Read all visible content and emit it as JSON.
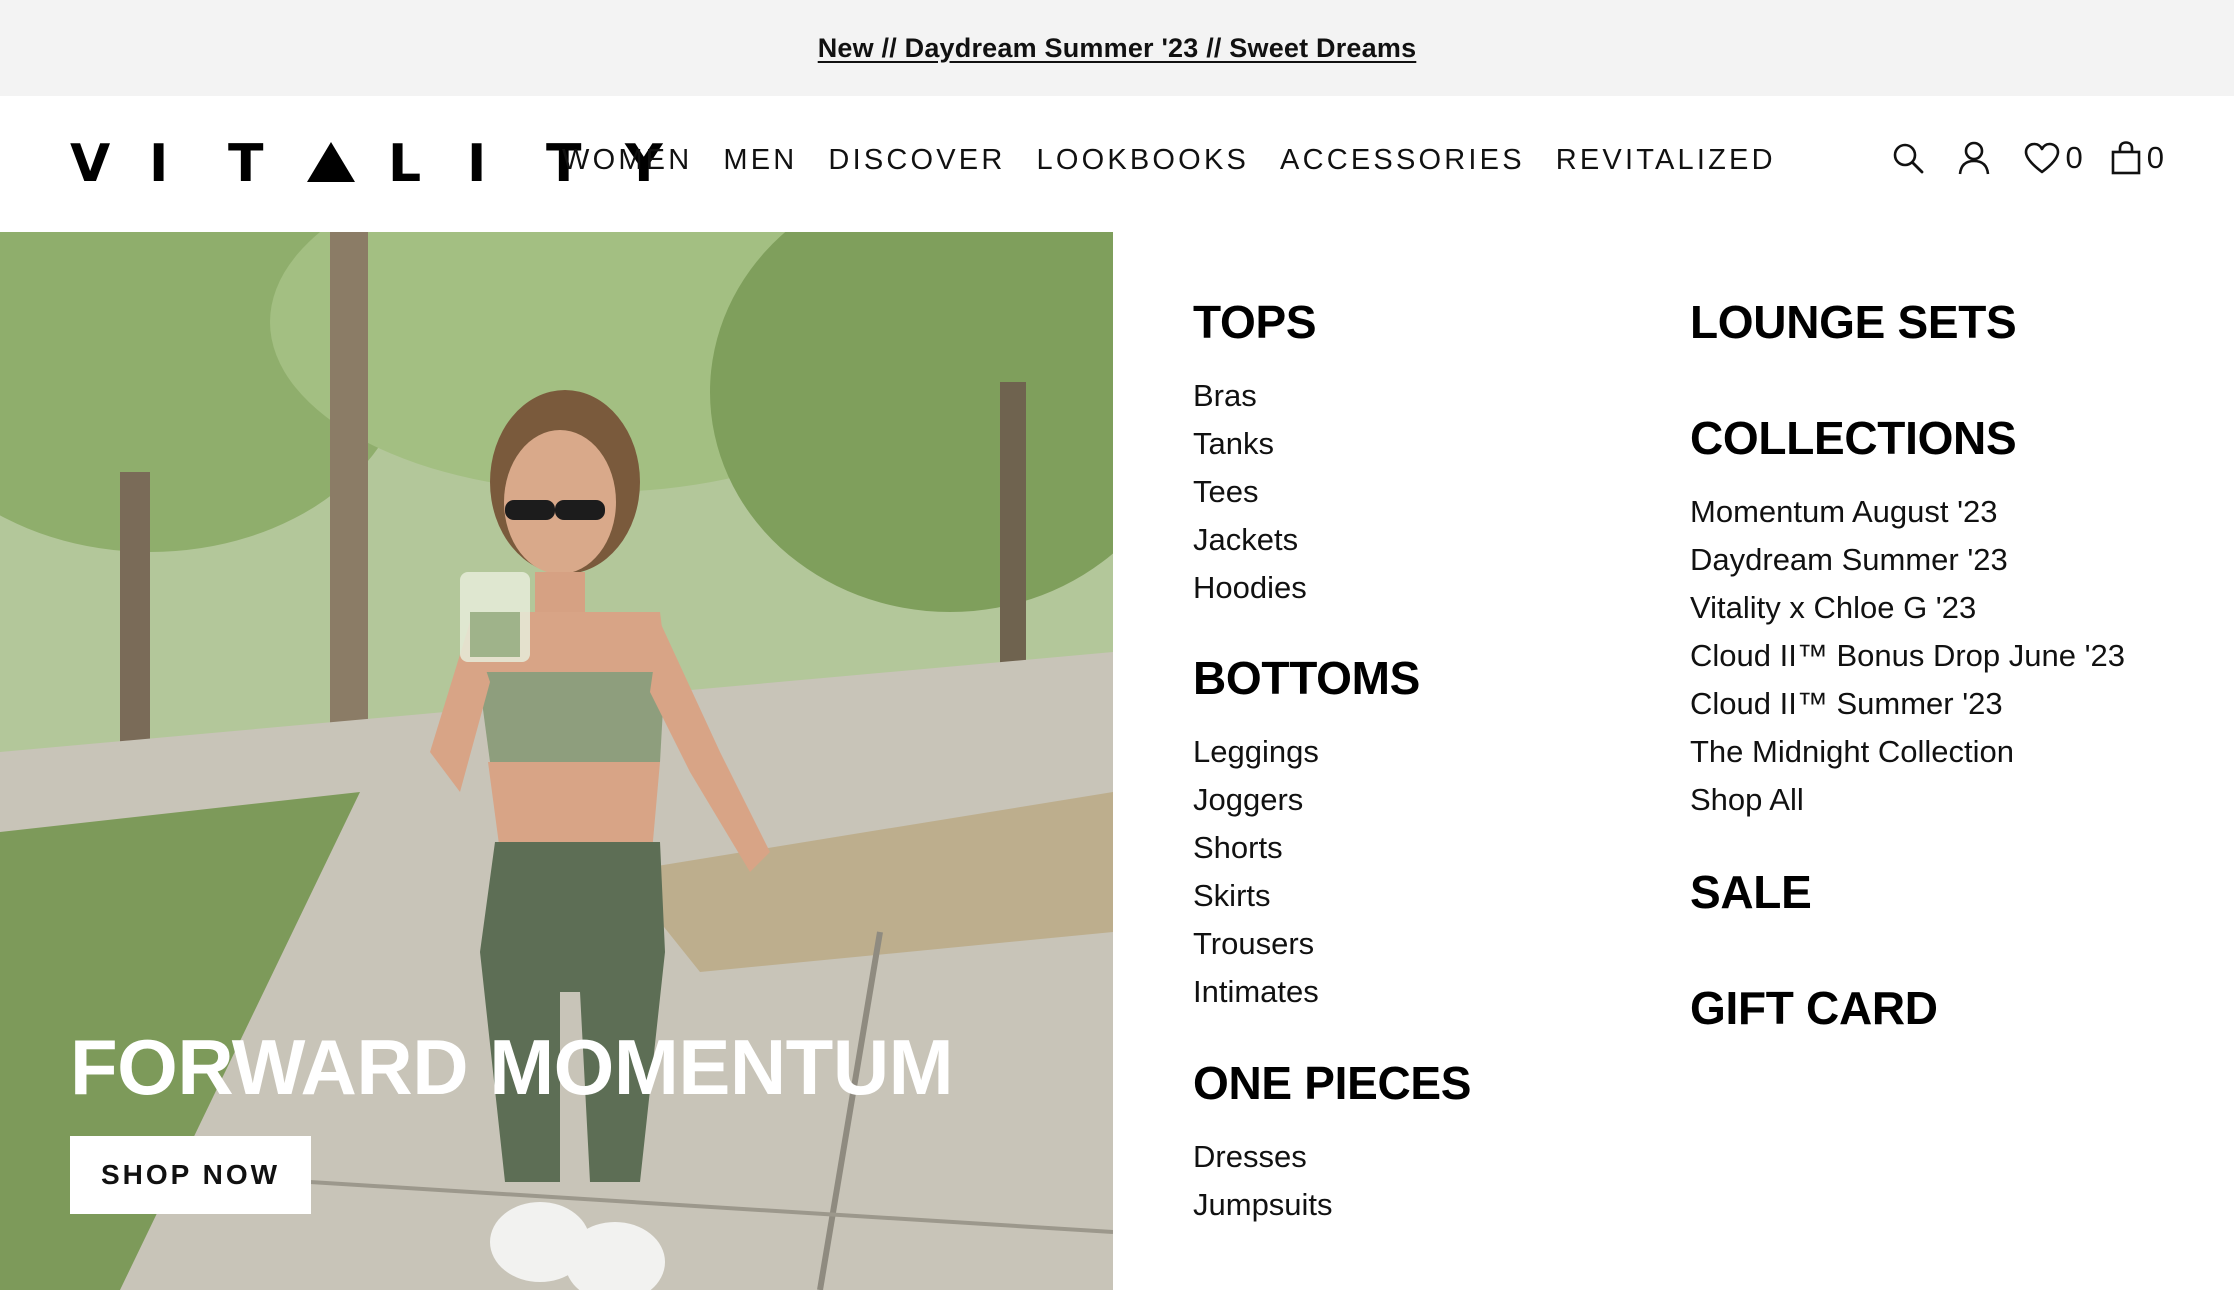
{
  "announcement": {
    "text": "New // Daydream Summer '23 // Sweet Dreams"
  },
  "header": {
    "logo_letters": [
      "V",
      "I",
      "T",
      "L",
      "I",
      "T",
      "Y"
    ],
    "logo_text": "VITALITY",
    "nav": [
      "WOMEN",
      "MEN",
      "DISCOVER",
      "LOOKBOOKS",
      "ACCESSORIES",
      "REVITALIZED"
    ],
    "wishlist_count": "0",
    "cart_count": "0",
    "icons": [
      "search-icon",
      "account-icon",
      "heart-icon",
      "bag-icon"
    ]
  },
  "hero": {
    "title": "FORWARD MOMENTUM",
    "button_label": "SHOP NOW"
  },
  "menu": {
    "tops": {
      "heading": "TOPS",
      "items": [
        "Bras",
        "Tanks",
        "Tees",
        "Jackets",
        "Hoodies"
      ]
    },
    "bottoms": {
      "heading": "BOTTOMS",
      "items": [
        "Leggings",
        "Joggers",
        "Shorts",
        "Skirts",
        "Trousers",
        "Intimates"
      ]
    },
    "one_pieces": {
      "heading": "ONE PIECES",
      "items": [
        "Dresses",
        "Jumpsuits"
      ]
    },
    "lounge_sets": {
      "heading": "LOUNGE SETS"
    },
    "collections": {
      "heading": "COLLECTIONS",
      "items": [
        "Momentum August '23",
        "Daydream Summer '23",
        "Vitality x Chloe G '23",
        "Cloud II™ Bonus Drop June '23",
        "Cloud II™ Summer '23",
        "The Midnight Collection",
        "Shop All"
      ]
    },
    "sale": {
      "heading": "SALE"
    },
    "gift_card": {
      "heading": "GIFT CARD"
    }
  },
  "colors": {
    "text": "#111111",
    "announce_bg": "#f3f3f3",
    "background": "#ffffff"
  }
}
